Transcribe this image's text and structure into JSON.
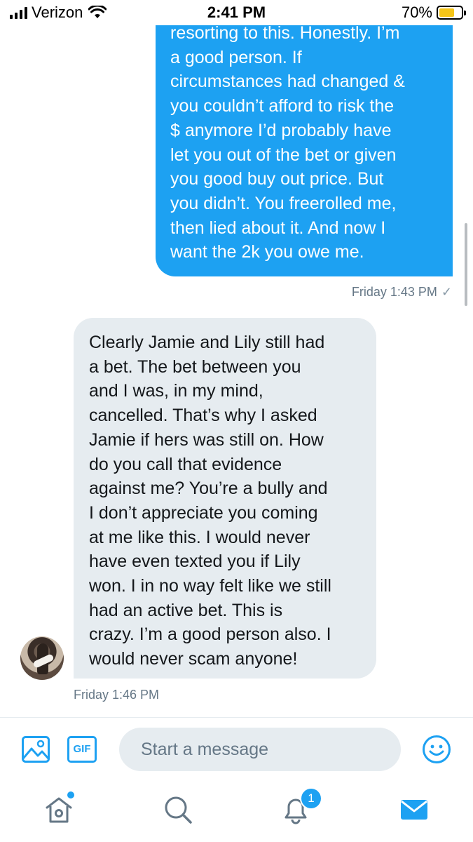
{
  "status_bar": {
    "carrier": "Verizon",
    "time": "2:41 PM",
    "battery_percent": "70%",
    "battery_level": 0.7
  },
  "conversation": {
    "messages": [
      {
        "direction": "sent",
        "text": "resorting to this. Honestly. I’m\na good person. If\ncircumstances had changed &\nyou couldn’t afford to risk the\n$ anymore I’d probably have\nlet you out of the bet or given\nyou good buy out price. But\nyou didn’t. You freerolled me,\nthen lied about it. And now I\nwant the 2k you owe me.",
        "timestamp": "Friday 1:43 PM",
        "read_mark": "✓"
      },
      {
        "direction": "received",
        "text": "Clearly Jamie and Lily still had\na bet. The bet between you\nand I was, in my mind,\ncancelled. That’s why I asked\nJamie if hers was still on. How\ndo you call that evidence\nagainst me? You’re a bully and\nI don’t appreciate you coming\nat me like this. I would never\nhave even texted you if Lily\nwon. I in no way felt like we still\nhad an active bet. This is\ncrazy. I’m a good person also. I\nwould never scam anyone!",
        "timestamp": "Friday 1:46 PM"
      }
    ]
  },
  "composer": {
    "placeholder": "Start a message",
    "value": "",
    "gif_label": "GIF",
    "image_icon": "image-icon",
    "emoji_icon": "emoji-icon"
  },
  "tab_bar": {
    "tabs": [
      {
        "name": "home",
        "icon": "home-icon"
      },
      {
        "name": "search",
        "icon": "search-icon"
      },
      {
        "name": "notifications",
        "icon": "bell-icon",
        "badge": "1"
      },
      {
        "name": "messages",
        "icon": "mail-icon",
        "active": true
      }
    ]
  },
  "colors": {
    "accent": "#1da1f2",
    "received_bubble": "#e6ecf0",
    "muted_text": "#657786",
    "battery_fill": "#f5c518"
  }
}
